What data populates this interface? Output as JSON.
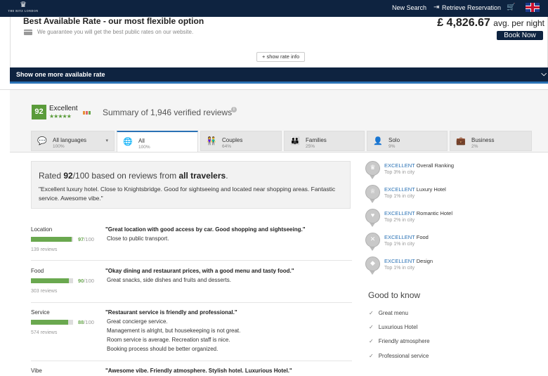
{
  "nav": {
    "logo_text": "THE RITZ LONDON",
    "new_search": "New Search",
    "retrieve": "Retrieve Reservation"
  },
  "rate": {
    "title": "Best Available Rate - our most flexible option",
    "subtitle": "We guarantee you will get the best public rates on our website.",
    "price": "£ 4,826.67",
    "price_unit": "avg. per night",
    "book_label": "Book Now",
    "show_info": "+ show rate info",
    "more_rate": "Show one more available rate"
  },
  "review": {
    "score": "92",
    "word": "Excellent",
    "stars": "★★★★★",
    "summary": "Summary of 1,946 verified reviews",
    "tabs": [
      {
        "label": "All languages",
        "pct": "100%"
      },
      {
        "label": "All",
        "pct": "100%"
      },
      {
        "label": "Couples",
        "pct": "64%"
      },
      {
        "label": "Families",
        "pct": "25%"
      },
      {
        "label": "Solo",
        "pct": "9%"
      },
      {
        "label": "Business",
        "pct": "2%"
      }
    ],
    "rated_pre": "Rated ",
    "rated_score": "92",
    "rated_mid": "/100 based on reviews from ",
    "rated_who": "all travelers",
    "rated_end": ".",
    "rated_quote": "\"Excellent luxury hotel. Close to Knightsbridge. Good for sightseeing and located near shopping areas. Fantastic service. Awesome vibe.\""
  },
  "categories": [
    {
      "name": "Location",
      "score": 97,
      "score_text": "97",
      "out_of": "/100",
      "count": "139 reviews",
      "headline": "\"Great location with good access by car. Good shopping and sightseeing.\"",
      "lines": [
        "Close to public transport."
      ]
    },
    {
      "name": "Food",
      "score": 90,
      "score_text": "90",
      "out_of": "/100",
      "count": "303 reviews",
      "headline": "\"Okay dining and restaurant prices, with a good menu and tasty food.\"",
      "lines": [
        "Great snacks, side dishes and fruits and desserts."
      ]
    },
    {
      "name": "Service",
      "score": 88,
      "score_text": "88",
      "out_of": "/100",
      "count": "574 reviews",
      "headline": "\"Restaurant service is friendly and professional.\"",
      "lines": [
        "Great concierge service.",
        "Management is alright, but housekeeping is not great.",
        "Room service is average. Recreation staff is nice.",
        "Booking process should be better organized."
      ]
    },
    {
      "name": "Vibe",
      "headline": "\"Awesome vibe. Friendly atmosphere. Stylish hotel. Luxurious Hotel.\""
    }
  ],
  "rankings": [
    {
      "excellent": "EXCELLENT",
      "label": "Overall Ranking",
      "sub": "Top 3% in city"
    },
    {
      "excellent": "EXCELLENT",
      "label": "Luxury Hotel",
      "sub": "Top 1% in city"
    },
    {
      "excellent": "EXCELLENT",
      "label": "Romantic Hotel",
      "sub": "Top 2% in city"
    },
    {
      "excellent": "EXCELLENT",
      "label": "Food",
      "sub": "Top 1% in city"
    },
    {
      "excellent": "EXCELLENT",
      "label": "Design",
      "sub": "Top 1% in city"
    }
  ],
  "good_to_know": {
    "title": "Good to know",
    "items": [
      "Great menu",
      "Luxurious Hotel",
      "Friendly atmosphere",
      "Professional service"
    ]
  },
  "colors": {
    "navy": "#0e2340",
    "accent_blue": "#2a72b5",
    "green": "#5a9b3a"
  }
}
